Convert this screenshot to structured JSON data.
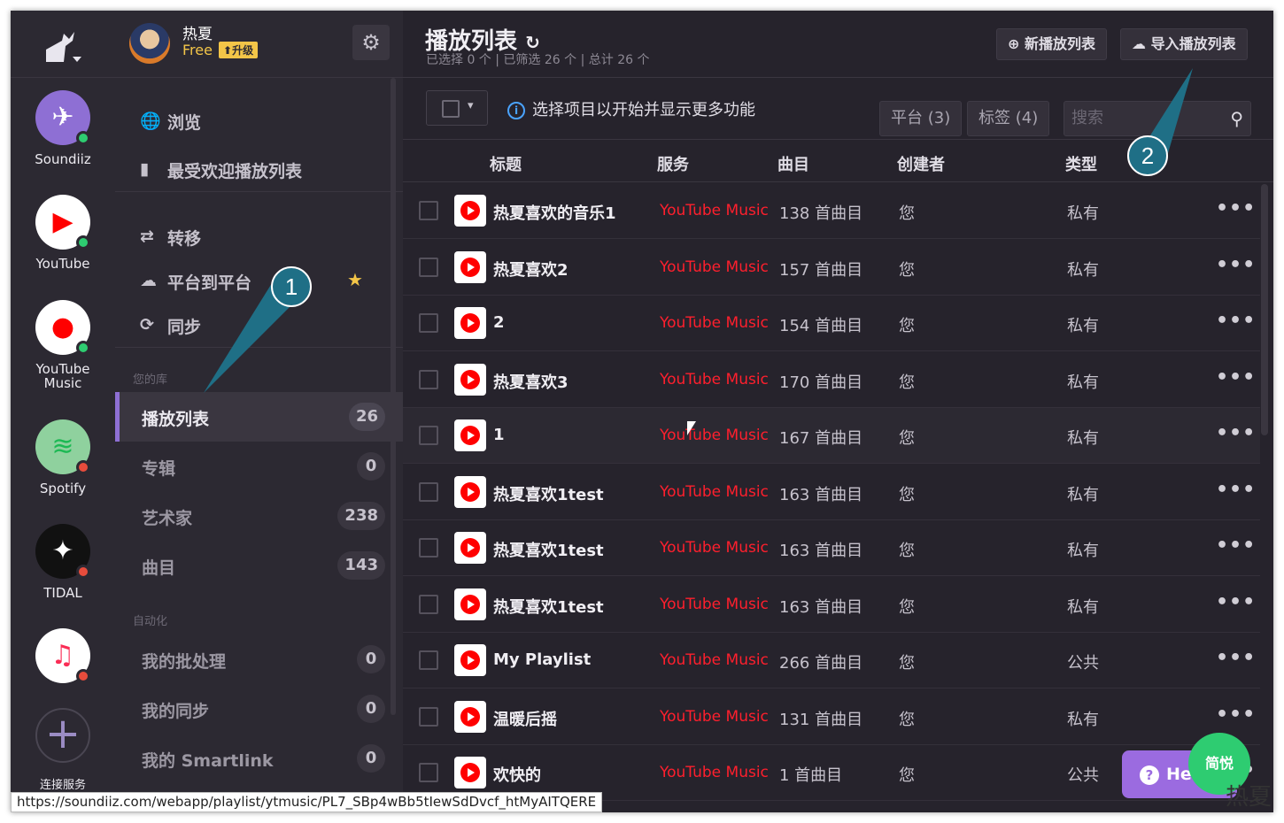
{
  "rail": {
    "services": [
      {
        "label": "Soundiiz",
        "status": "on"
      },
      {
        "label": "YouTube",
        "status": "on"
      },
      {
        "label": "YouTube Music",
        "status": "on"
      },
      {
        "label": "Spotify",
        "status": "off"
      },
      {
        "label": "TIDAL",
        "status": "off"
      },
      {
        "label": "",
        "status": "off"
      }
    ],
    "add_label": "连接服务"
  },
  "user": {
    "name": "热夏",
    "plan": "Free",
    "upgrade": "升级"
  },
  "nav": {
    "browse": "浏览",
    "popular": "最受欢迎播放列表",
    "transfer": "转移",
    "platform": "平台到平台",
    "sync": "同步"
  },
  "library": {
    "caption": "您的库",
    "items": [
      {
        "label": "播放列表",
        "count": "26"
      },
      {
        "label": "专辑",
        "count": "0"
      },
      {
        "label": "艺术家",
        "count": "238"
      },
      {
        "label": "曲目",
        "count": "143"
      }
    ]
  },
  "automation": {
    "caption": "自动化",
    "items": [
      {
        "label": "我的批处理",
        "count": "0"
      },
      {
        "label": "我的同步",
        "count": "0"
      },
      {
        "label": "我的 Smartlink",
        "count": "0"
      }
    ]
  },
  "header": {
    "title": "播放列表",
    "subtitle": "已选择 0 个 | 已筛选 26 个 | 总计 26 个",
    "new_playlist": "新播放列表",
    "import_playlist": "导入播放列表"
  },
  "toolbar": {
    "info": "选择项目以开始并显示更多功能",
    "platform_filter": "平台 (3)",
    "tag_filter": "标签 (4)",
    "search_placeholder": "搜索"
  },
  "table": {
    "columns": [
      "标题",
      "服务",
      "曲目",
      "创建者",
      "类型"
    ],
    "rows": [
      {
        "title": "热夏喜欢的音乐1",
        "service": "YouTube Music",
        "tracks": "138 首曲目",
        "creator": "您",
        "type": "私有"
      },
      {
        "title": "热夏喜欢2",
        "service": "YouTube Music",
        "tracks": "157 首曲目",
        "creator": "您",
        "type": "私有"
      },
      {
        "title": "2",
        "service": "YouTube Music",
        "tracks": "154 首曲目",
        "creator": "您",
        "type": "私有"
      },
      {
        "title": "热夏喜欢3",
        "service": "YouTube Music",
        "tracks": "170 首曲目",
        "creator": "您",
        "type": "私有"
      },
      {
        "title": "1",
        "service": "YouTube Music",
        "tracks": "167 首曲目",
        "creator": "您",
        "type": "私有"
      },
      {
        "title": "热夏喜欢1test",
        "service": "YouTube Music",
        "tracks": "163 首曲目",
        "creator": "您",
        "type": "私有"
      },
      {
        "title": "热夏喜欢1test",
        "service": "YouTube Music",
        "tracks": "163 首曲目",
        "creator": "您",
        "type": "私有"
      },
      {
        "title": "热夏喜欢1test",
        "service": "YouTube Music",
        "tracks": "163 首曲目",
        "creator": "您",
        "type": "私有"
      },
      {
        "title": "My Playlist",
        "service": "YouTube Music",
        "tracks": "266 首曲目",
        "creator": "您",
        "type": "公共"
      },
      {
        "title": "温暖后摇",
        "service": "YouTube Music",
        "tracks": "131 首曲目",
        "creator": "您",
        "type": "私有"
      },
      {
        "title": "欢快的",
        "service": "YouTube Music",
        "tracks": "1 首曲目",
        "creator": "您",
        "type": "公共"
      }
    ]
  },
  "help": "Help",
  "watermark": {
    "badge": "简悦",
    "text": "热夏"
  },
  "callouts": [
    "1",
    "2"
  ],
  "status_url": "https://soundiiz.com/webapp/playlist/ytmusic/PL7_SBp4wBb5tIewSdDvcf_htMyAITQERE"
}
